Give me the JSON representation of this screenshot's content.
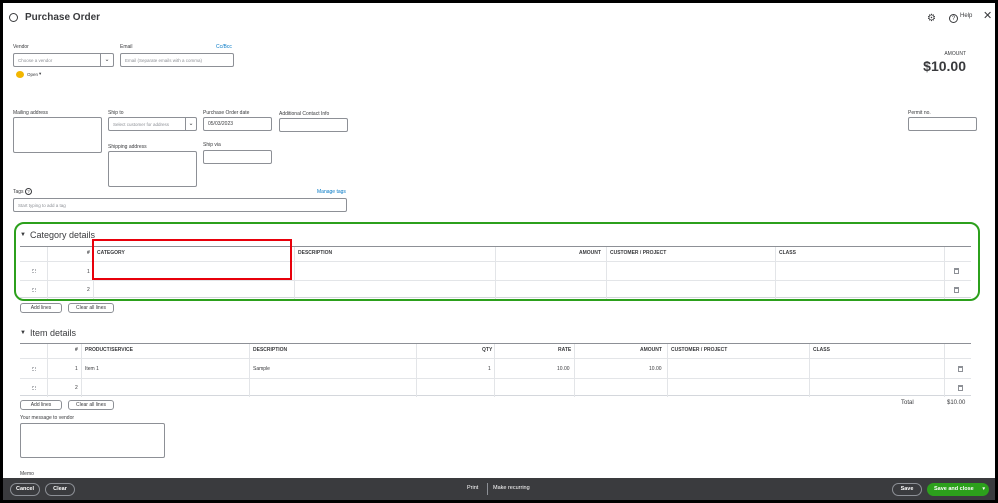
{
  "header": {
    "title": "Purchase Order",
    "help_label": "Help"
  },
  "vendor": {
    "label": "Vendor",
    "placeholder": "Choose a vendor",
    "status": "Open"
  },
  "email": {
    "label": "Email",
    "placeholder": "Email (Separate emails with a comma)",
    "ccbcc": "Cc/Bcc"
  },
  "amount": {
    "label": "AMOUNT",
    "value": "$10.00"
  },
  "mailing": {
    "label": "Mailing address"
  },
  "ship_to": {
    "label": "Ship to",
    "placeholder": "Select customer for address"
  },
  "po_date": {
    "label": "Purchase Order date",
    "value": "05/03/2023"
  },
  "additional": {
    "label": "Additional Contact Info"
  },
  "permit": {
    "label": "Permit no."
  },
  "shipping": {
    "label": "Shipping address"
  },
  "ship_via": {
    "label": "Ship via"
  },
  "tags": {
    "label": "Tags",
    "manage": "Manage tags",
    "placeholder": "Start typing to add a tag"
  },
  "category": {
    "title": "Category details",
    "columns": {
      "num": "#",
      "category": "CATEGORY",
      "description": "DESCRIPTION",
      "amount": "AMOUNT",
      "customer": "CUSTOMER / PROJECT",
      "class": "CLASS"
    },
    "rows": [
      {
        "num": "1"
      },
      {
        "num": "2"
      }
    ],
    "add_lines": "Add lines",
    "clear_lines": "Clear all lines"
  },
  "items": {
    "title": "Item details",
    "columns": {
      "num": "#",
      "product": "PRODUCT/SERVICE",
      "description": "DESCRIPTION",
      "qty": "QTY",
      "rate": "RATE",
      "amount": "AMOUNT",
      "customer": "CUSTOMER / PROJECT",
      "class": "CLASS"
    },
    "rows": [
      {
        "num": "1",
        "product": "Item 1",
        "description": "Sample",
        "qty": "1",
        "rate": "10.00",
        "amount": "10.00"
      },
      {
        "num": "2",
        "product": "",
        "description": "",
        "qty": "",
        "rate": "",
        "amount": ""
      }
    ],
    "add_lines": "Add lines",
    "clear_lines": "Clear all lines"
  },
  "total": {
    "label": "Total",
    "value": "$10.00"
  },
  "message": {
    "label": "Your message to vendor"
  },
  "memo": {
    "label": "Memo"
  },
  "footer": {
    "cancel": "Cancel",
    "clear": "Clear",
    "print": "Print",
    "recurring": "Make recurring",
    "save": "Save",
    "save_close": "Save and close"
  },
  "colors": {
    "green_highlight": "#2ca01c",
    "red_highlight": "#e8000b",
    "footer_bg": "#3a3b3e",
    "save_close_bg": "#2ca01c",
    "amount_text": "#393a3d"
  }
}
